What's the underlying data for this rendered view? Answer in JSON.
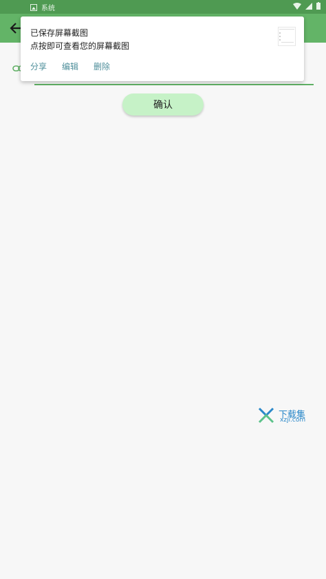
{
  "statusbar": {
    "app_label": "系统"
  },
  "appbar": {
    "back_icon": "arrow-back-icon"
  },
  "notification": {
    "title": "已保存屏幕截图",
    "subtitle": "点按即可查看您的屏幕截图",
    "actions": [
      "分享",
      "编辑",
      "删除"
    ]
  },
  "form": {
    "confirm_label": "确认"
  },
  "watermark": {
    "brand": "下载集",
    "site": "xzji.com"
  },
  "colors": {
    "status": "#4f9a52",
    "appbar": "#63b467",
    "accent": "#5fb064",
    "confirm_bg": "#c6f2c7"
  }
}
